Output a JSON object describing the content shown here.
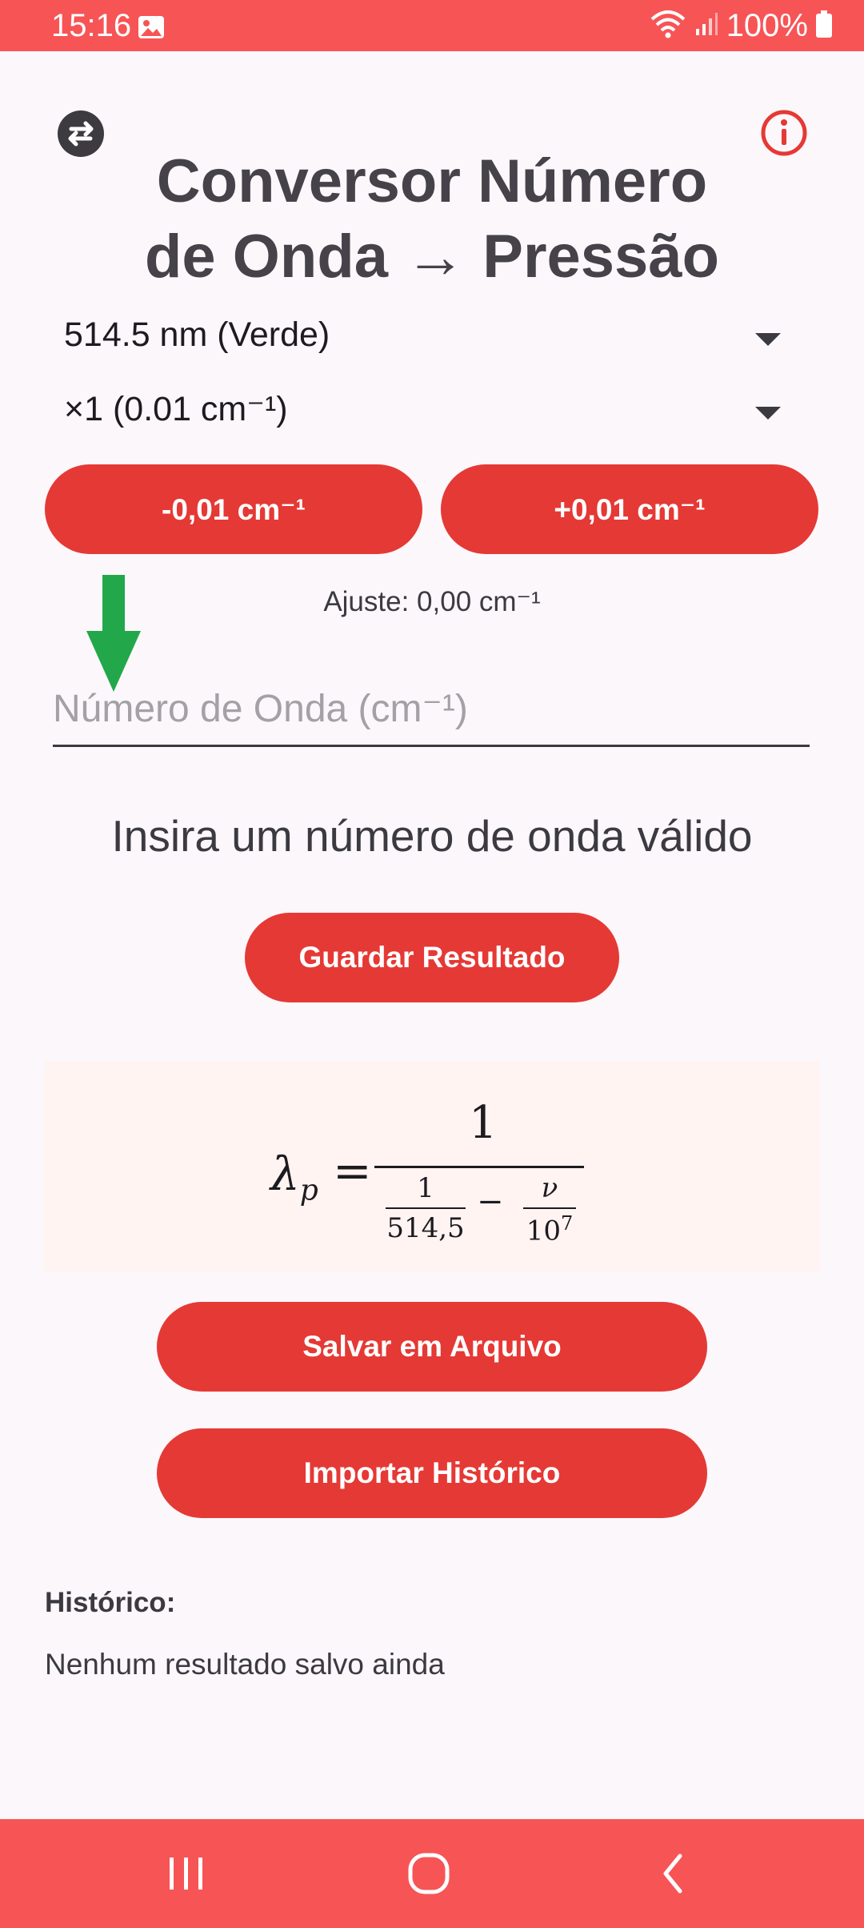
{
  "status_bar": {
    "time": "15:16",
    "battery": "100%"
  },
  "header": {
    "title_line1": "Conversor Número",
    "title_line2": "de Onda → Pressão"
  },
  "selectors": {
    "laser": {
      "value": "514.5 nm (Verde)"
    },
    "step": {
      "value": "×1 (0.01 cm⁻¹)"
    }
  },
  "adjust_buttons": {
    "minus_label": "-0,01 cm⁻¹",
    "plus_label": "+0,01 cm⁻¹"
  },
  "adjust_text": "Ajuste: 0,00 cm⁻¹",
  "input": {
    "placeholder": "Número de Onda (cm⁻¹)",
    "value": ""
  },
  "message": "Insira um número de onda válido",
  "buttons": {
    "save_result": "Guardar Resultado",
    "save_file": "Salvar em Arquivo",
    "import_history": "Importar Histórico"
  },
  "formula": {
    "lhs": "λ",
    "lhs_sub": "p",
    "eq": "=",
    "numerator": "1",
    "frac1_num": "1",
    "frac1_den": "514,5",
    "minus": "−",
    "frac2_num": "ν",
    "frac2_den_base": "10",
    "frac2_den_exp": "7"
  },
  "history": {
    "title": "Histórico:",
    "empty_text": "Nenhum resultado salvo ainda"
  },
  "colors": {
    "accent": "#E53935",
    "bars": "#F75456",
    "background": "#FCF7FA",
    "formula_bg": "#FFF4F2",
    "arrow": "#22A84A"
  },
  "icons": [
    "gallery-icon",
    "wifi-icon",
    "signal-icon",
    "battery-icon",
    "swap-icon",
    "info-icon",
    "arrow-down-icon",
    "recents-icon",
    "home-icon",
    "back-icon"
  ]
}
